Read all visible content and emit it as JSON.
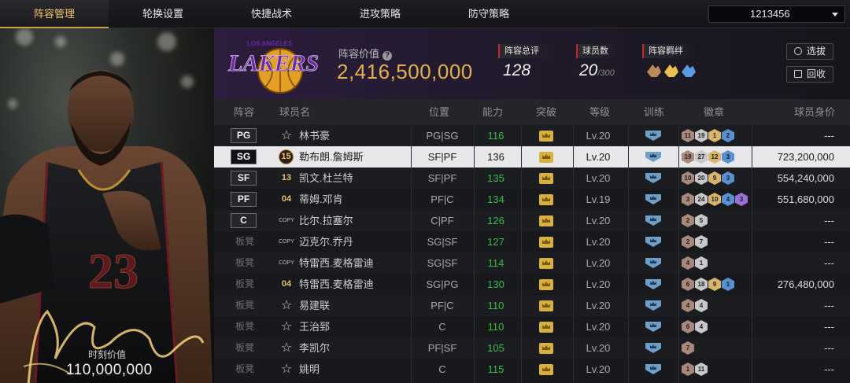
{
  "nav": {
    "tabs": [
      {
        "label": "阵容管理"
      },
      {
        "label": "轮换设置"
      },
      {
        "label": "快捷战术"
      },
      {
        "label": "进攻策略"
      },
      {
        "label": "防守策略"
      }
    ],
    "account_select": "1213456"
  },
  "player_card": {
    "jersey_number": "23",
    "market_value_label": "时刻价值",
    "market_value": "110,000,000"
  },
  "team": {
    "logo_text": "LAKERS",
    "logo_subtext": "LOS ANGELES",
    "lineup_value_label": "阵容价值",
    "lineup_value": "2,416,500,000",
    "overall_label": "阵容总评",
    "overall_value": "128",
    "players_label": "球员数",
    "players_value": "20",
    "players_max": "/300",
    "bond_label": "阵容羁绊",
    "select_button": "选拔",
    "recycle_button": "回收"
  },
  "table": {
    "headers": {
      "lineup": "阵容",
      "name": "球员名",
      "position": "位置",
      "ability": "能力",
      "breakthrough": "突破",
      "level": "等级",
      "training": "训练",
      "badges": "徽章",
      "value": "球员身价"
    },
    "rows": [
      {
        "slot": "PG",
        "jersey": "☆",
        "name": "林书豪",
        "position": "PG|SG",
        "ability": "116",
        "level": "Lv.20",
        "badges": [
          "11",
          "19",
          "1",
          "2"
        ],
        "value": "---"
      },
      {
        "slot": "SG",
        "jersey": "15",
        "name": "勒布朗.詹姆斯",
        "position": "SF|PF",
        "ability": "136",
        "level": "Lv.20",
        "badges": [
          "19",
          "27",
          "12",
          "3"
        ],
        "value": "723,200,000"
      },
      {
        "slot": "SF",
        "jersey": "13",
        "name": "凯文.杜兰特",
        "position": "SF|PF",
        "ability": "135",
        "level": "Lv.20",
        "badges": [
          "10",
          "20",
          "9",
          "3"
        ],
        "value": "554,240,000"
      },
      {
        "slot": "PF",
        "jersey": "04",
        "name": "蒂姆.邓肯",
        "position": "PF|C",
        "ability": "134",
        "level": "Lv.19",
        "badges": [
          "3",
          "24",
          "10",
          "4",
          "3"
        ],
        "value": "551,680,000"
      },
      {
        "slot": "C",
        "jersey": "COPY",
        "name": "比尔.拉塞尔",
        "position": "C|PF",
        "ability": "126",
        "level": "Lv.20",
        "badges": [
          "2",
          "5"
        ],
        "value": "---"
      },
      {
        "slot": "板凳",
        "jersey": "COPY",
        "name": "迈克尔.乔丹",
        "position": "SG|SF",
        "ability": "127",
        "level": "Lv.20",
        "badges": [
          "2",
          "7"
        ],
        "value": "---"
      },
      {
        "slot": "板凳",
        "jersey": "COPY",
        "name": "特雷西.麦格雷迪",
        "position": "SG|SF",
        "ability": "114",
        "level": "Lv.20",
        "badges": [
          "4",
          "1"
        ],
        "value": "---"
      },
      {
        "slot": "板凳",
        "jersey": "04",
        "name": "特雷西.麦格雷迪",
        "position": "SG|PG",
        "ability": "130",
        "level": "Lv.20",
        "badges": [
          "6",
          "18",
          "9",
          "1"
        ],
        "value": "276,480,000"
      },
      {
        "slot": "板凳",
        "jersey": "☆",
        "name": "易建联",
        "position": "PF|C",
        "ability": "110",
        "level": "Lv.20",
        "badges": [
          "4",
          "4"
        ],
        "value": "---"
      },
      {
        "slot": "板凳",
        "jersey": "☆",
        "name": "王治郅",
        "position": "C",
        "ability": "110",
        "level": "Lv.20",
        "badges": [
          "6",
          "4"
        ],
        "value": "---"
      },
      {
        "slot": "板凳",
        "jersey": "☆",
        "name": "李凯尔",
        "position": "PF|SF",
        "ability": "105",
        "level": "Lv.20",
        "badges": [
          "7"
        ],
        "value": "---"
      },
      {
        "slot": "板凳",
        "jersey": "☆",
        "name": "姚明",
        "position": "C",
        "ability": "115",
        "level": "Lv.20",
        "badges": [
          "1",
          "11"
        ],
        "value": "---"
      }
    ]
  },
  "colors": {
    "accent_gold": "#e2b14d",
    "ability_green": "#3dbb48",
    "stat_marker_red": "#c02a2a",
    "selected_row": "#e8e8ea"
  }
}
